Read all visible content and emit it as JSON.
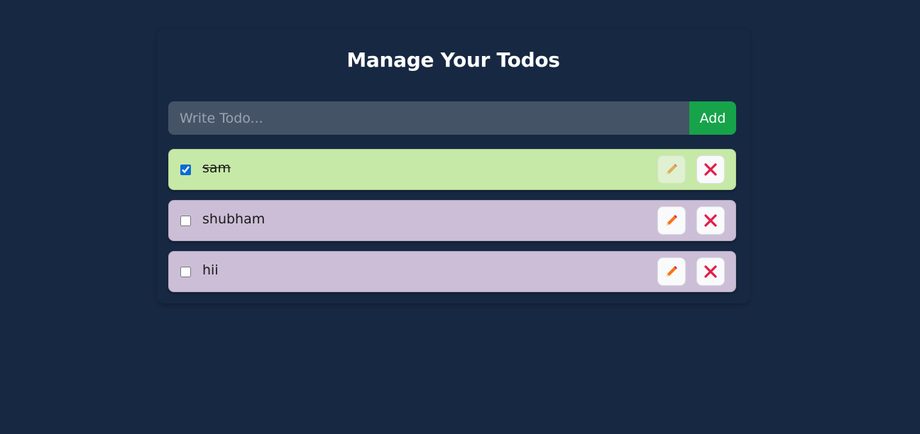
{
  "header": {
    "title": "Manage Your Todos"
  },
  "form": {
    "placeholder": "Write Todo...",
    "value": "",
    "add_label": "Add"
  },
  "todos": [
    {
      "text": "sam",
      "completed": true
    },
    {
      "text": "shubham",
      "completed": false
    },
    {
      "text": "hii",
      "completed": false
    }
  ],
  "icons": {
    "edit": "pencil-icon",
    "delete": "close-icon"
  },
  "colors": {
    "background": "#172842",
    "add_button": "#16a34a",
    "completed_item": "#c6e9a7",
    "pending_item": "#ccbed7",
    "delete_icon": "#e11d48",
    "edit_icon": "#f97316"
  }
}
